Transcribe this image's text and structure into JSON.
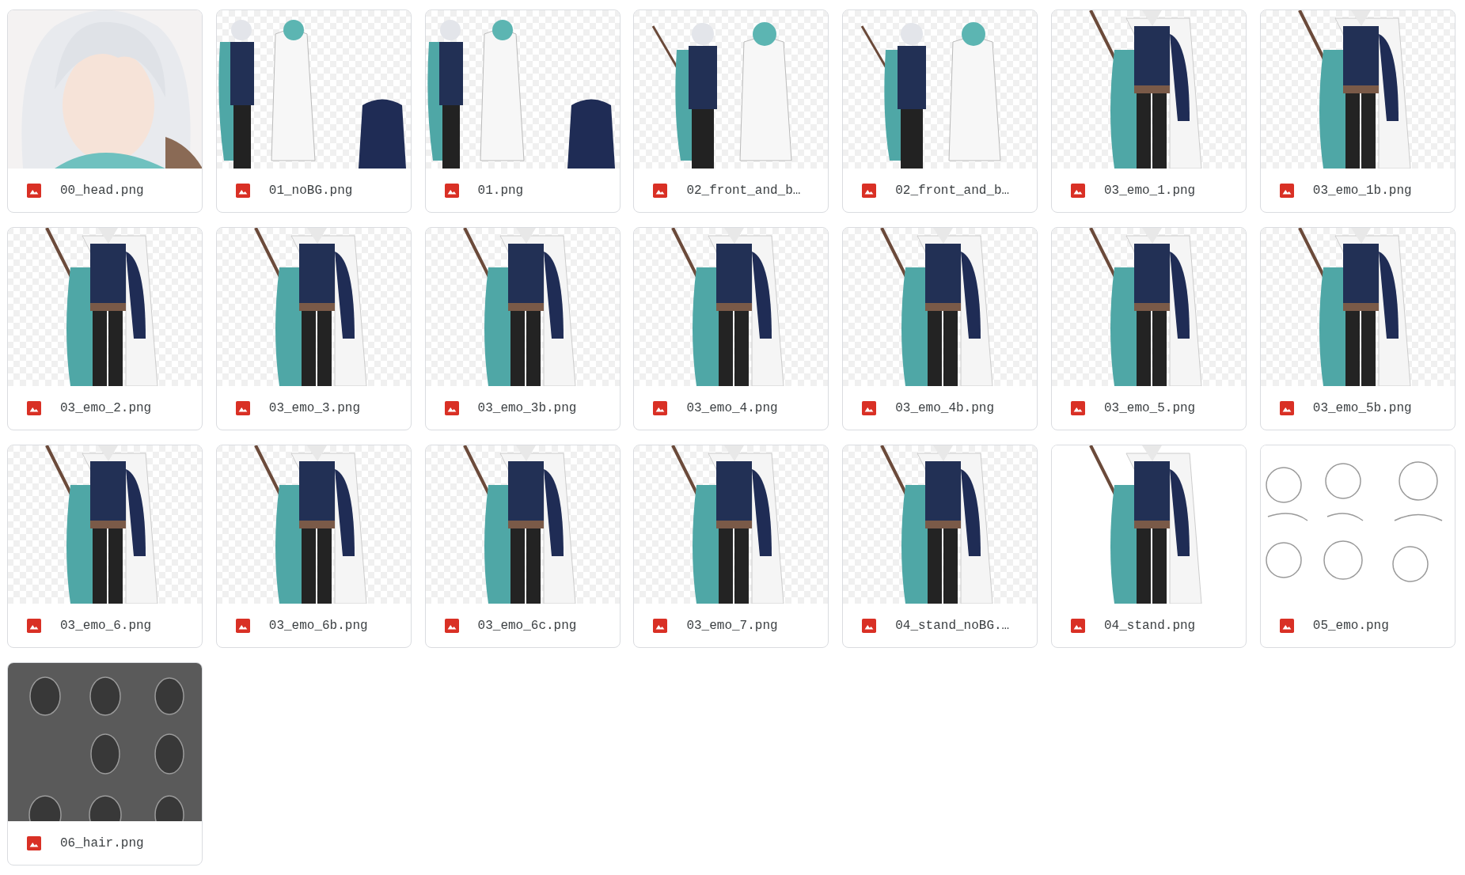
{
  "files": [
    {
      "name": "00_head.png"
    },
    {
      "name": "01_noBG.png"
    },
    {
      "name": "01.png"
    },
    {
      "name": "02_front_and_b…"
    },
    {
      "name": "02_front_and_b…"
    },
    {
      "name": "03_emo_1.png"
    },
    {
      "name": "03_emo_1b.png"
    },
    {
      "name": "03_emo_2.png"
    },
    {
      "name": "03_emo_3.png"
    },
    {
      "name": "03_emo_3b.png"
    },
    {
      "name": "03_emo_4.png"
    },
    {
      "name": "03_emo_4b.png"
    },
    {
      "name": "03_emo_5.png"
    },
    {
      "name": "03_emo_5b.png"
    },
    {
      "name": "03_emo_6.png"
    },
    {
      "name": "03_emo_6b.png"
    },
    {
      "name": "03_emo_6c.png"
    },
    {
      "name": "03_emo_7.png"
    },
    {
      "name": "04_stand_noBG.…"
    },
    {
      "name": "04_stand.png"
    },
    {
      "name": "05_emo.png"
    },
    {
      "name": "06_hair.png"
    }
  ]
}
